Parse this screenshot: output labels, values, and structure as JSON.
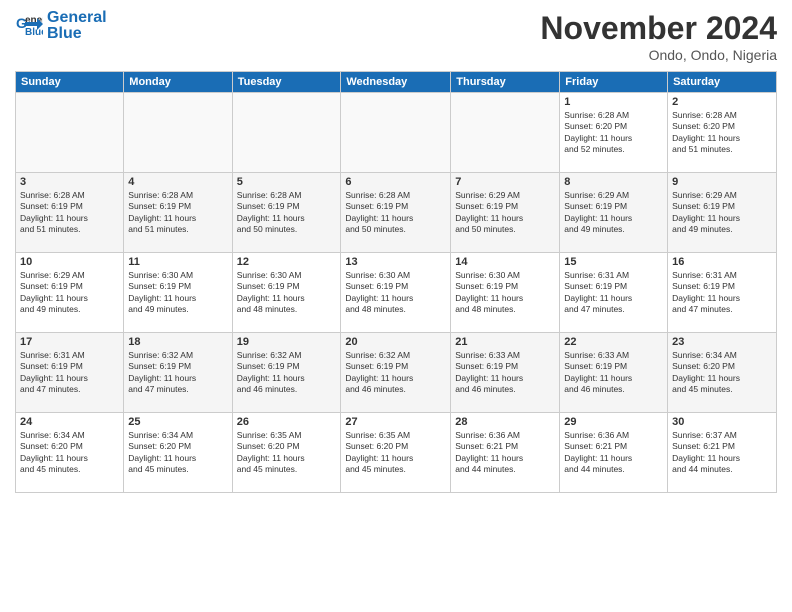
{
  "header": {
    "logo_line1": "General",
    "logo_line2": "Blue",
    "month_title": "November 2024",
    "location": "Ondo, Ondo, Nigeria"
  },
  "days_of_week": [
    "Sunday",
    "Monday",
    "Tuesday",
    "Wednesday",
    "Thursday",
    "Friday",
    "Saturday"
  ],
  "weeks": [
    [
      {
        "day": "",
        "info": ""
      },
      {
        "day": "",
        "info": ""
      },
      {
        "day": "",
        "info": ""
      },
      {
        "day": "",
        "info": ""
      },
      {
        "day": "",
        "info": ""
      },
      {
        "day": "1",
        "info": "Sunrise: 6:28 AM\nSunset: 6:20 PM\nDaylight: 11 hours\nand 52 minutes."
      },
      {
        "day": "2",
        "info": "Sunrise: 6:28 AM\nSunset: 6:20 PM\nDaylight: 11 hours\nand 51 minutes."
      }
    ],
    [
      {
        "day": "3",
        "info": "Sunrise: 6:28 AM\nSunset: 6:19 PM\nDaylight: 11 hours\nand 51 minutes."
      },
      {
        "day": "4",
        "info": "Sunrise: 6:28 AM\nSunset: 6:19 PM\nDaylight: 11 hours\nand 51 minutes."
      },
      {
        "day": "5",
        "info": "Sunrise: 6:28 AM\nSunset: 6:19 PM\nDaylight: 11 hours\nand 50 minutes."
      },
      {
        "day": "6",
        "info": "Sunrise: 6:28 AM\nSunset: 6:19 PM\nDaylight: 11 hours\nand 50 minutes."
      },
      {
        "day": "7",
        "info": "Sunrise: 6:29 AM\nSunset: 6:19 PM\nDaylight: 11 hours\nand 50 minutes."
      },
      {
        "day": "8",
        "info": "Sunrise: 6:29 AM\nSunset: 6:19 PM\nDaylight: 11 hours\nand 49 minutes."
      },
      {
        "day": "9",
        "info": "Sunrise: 6:29 AM\nSunset: 6:19 PM\nDaylight: 11 hours\nand 49 minutes."
      }
    ],
    [
      {
        "day": "10",
        "info": "Sunrise: 6:29 AM\nSunset: 6:19 PM\nDaylight: 11 hours\nand 49 minutes."
      },
      {
        "day": "11",
        "info": "Sunrise: 6:30 AM\nSunset: 6:19 PM\nDaylight: 11 hours\nand 49 minutes."
      },
      {
        "day": "12",
        "info": "Sunrise: 6:30 AM\nSunset: 6:19 PM\nDaylight: 11 hours\nand 48 minutes."
      },
      {
        "day": "13",
        "info": "Sunrise: 6:30 AM\nSunset: 6:19 PM\nDaylight: 11 hours\nand 48 minutes."
      },
      {
        "day": "14",
        "info": "Sunrise: 6:30 AM\nSunset: 6:19 PM\nDaylight: 11 hours\nand 48 minutes."
      },
      {
        "day": "15",
        "info": "Sunrise: 6:31 AM\nSunset: 6:19 PM\nDaylight: 11 hours\nand 47 minutes."
      },
      {
        "day": "16",
        "info": "Sunrise: 6:31 AM\nSunset: 6:19 PM\nDaylight: 11 hours\nand 47 minutes."
      }
    ],
    [
      {
        "day": "17",
        "info": "Sunrise: 6:31 AM\nSunset: 6:19 PM\nDaylight: 11 hours\nand 47 minutes."
      },
      {
        "day": "18",
        "info": "Sunrise: 6:32 AM\nSunset: 6:19 PM\nDaylight: 11 hours\nand 47 minutes."
      },
      {
        "day": "19",
        "info": "Sunrise: 6:32 AM\nSunset: 6:19 PM\nDaylight: 11 hours\nand 46 minutes."
      },
      {
        "day": "20",
        "info": "Sunrise: 6:32 AM\nSunset: 6:19 PM\nDaylight: 11 hours\nand 46 minutes."
      },
      {
        "day": "21",
        "info": "Sunrise: 6:33 AM\nSunset: 6:19 PM\nDaylight: 11 hours\nand 46 minutes."
      },
      {
        "day": "22",
        "info": "Sunrise: 6:33 AM\nSunset: 6:19 PM\nDaylight: 11 hours\nand 46 minutes."
      },
      {
        "day": "23",
        "info": "Sunrise: 6:34 AM\nSunset: 6:20 PM\nDaylight: 11 hours\nand 45 minutes."
      }
    ],
    [
      {
        "day": "24",
        "info": "Sunrise: 6:34 AM\nSunset: 6:20 PM\nDaylight: 11 hours\nand 45 minutes."
      },
      {
        "day": "25",
        "info": "Sunrise: 6:34 AM\nSunset: 6:20 PM\nDaylight: 11 hours\nand 45 minutes."
      },
      {
        "day": "26",
        "info": "Sunrise: 6:35 AM\nSunset: 6:20 PM\nDaylight: 11 hours\nand 45 minutes."
      },
      {
        "day": "27",
        "info": "Sunrise: 6:35 AM\nSunset: 6:20 PM\nDaylight: 11 hours\nand 45 minutes."
      },
      {
        "day": "28",
        "info": "Sunrise: 6:36 AM\nSunset: 6:21 PM\nDaylight: 11 hours\nand 44 minutes."
      },
      {
        "day": "29",
        "info": "Sunrise: 6:36 AM\nSunset: 6:21 PM\nDaylight: 11 hours\nand 44 minutes."
      },
      {
        "day": "30",
        "info": "Sunrise: 6:37 AM\nSunset: 6:21 PM\nDaylight: 11 hours\nand 44 minutes."
      }
    ]
  ]
}
